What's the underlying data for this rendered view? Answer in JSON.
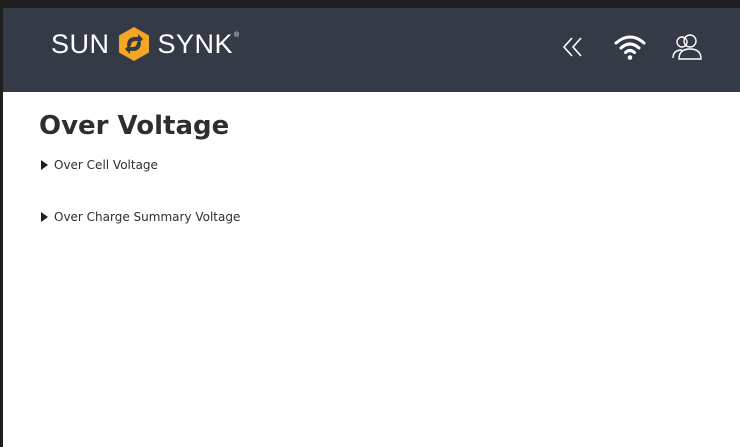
{
  "header": {
    "logo_left": "SUN",
    "logo_right": "SYNK",
    "logo_reg": "®",
    "icons": {
      "back": "double-chevron-left-icon",
      "wifi": "wifi-icon",
      "user": "users-icon"
    },
    "colors": {
      "header_bg": "#353a47",
      "logo_accent": "#f5a623"
    }
  },
  "page": {
    "title": "Over Voltage",
    "items": [
      {
        "label": "Over Cell Voltage"
      },
      {
        "label": "Over Charge Summary Voltage"
      }
    ]
  }
}
